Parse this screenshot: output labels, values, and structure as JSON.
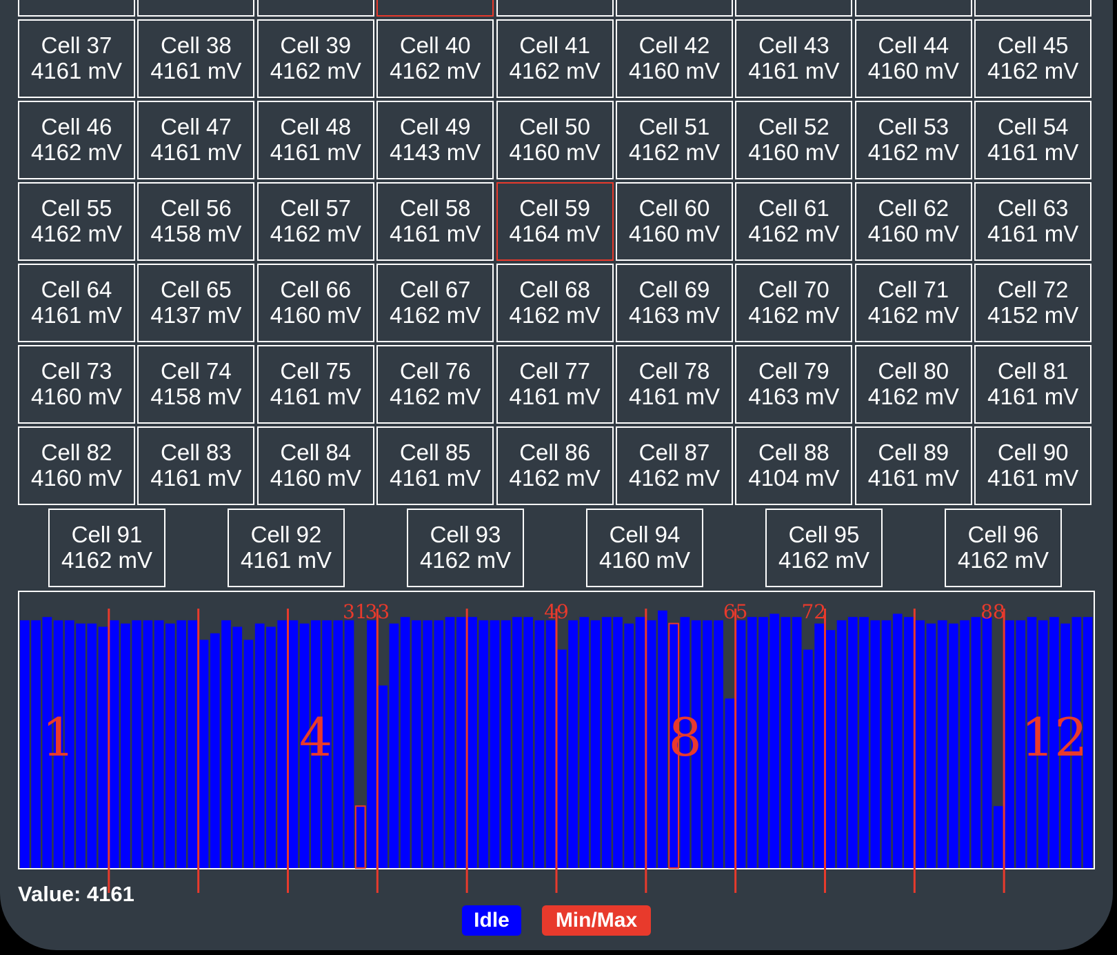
{
  "cells": [
    {
      "label": "Cell 37",
      "value": "4161 mV"
    },
    {
      "label": "Cell 38",
      "value": "4161 mV"
    },
    {
      "label": "Cell 39",
      "value": "4162 mV"
    },
    {
      "label": "Cell 40",
      "value": "4162 mV"
    },
    {
      "label": "Cell 41",
      "value": "4162 mV"
    },
    {
      "label": "Cell 42",
      "value": "4160 mV"
    },
    {
      "label": "Cell 43",
      "value": "4161 mV"
    },
    {
      "label": "Cell 44",
      "value": "4160 mV"
    },
    {
      "label": "Cell 45",
      "value": "4162 mV"
    },
    {
      "label": "Cell 46",
      "value": "4162 mV"
    },
    {
      "label": "Cell 47",
      "value": "4161 mV"
    },
    {
      "label": "Cell 48",
      "value": "4161 mV"
    },
    {
      "label": "Cell 49",
      "value": "4143 mV"
    },
    {
      "label": "Cell 50",
      "value": "4160 mV"
    },
    {
      "label": "Cell 51",
      "value": "4162 mV"
    },
    {
      "label": "Cell 52",
      "value": "4160 mV"
    },
    {
      "label": "Cell 53",
      "value": "4162 mV"
    },
    {
      "label": "Cell 54",
      "value": "4161 mV"
    },
    {
      "label": "Cell 55",
      "value": "4162 mV"
    },
    {
      "label": "Cell 56",
      "value": "4158 mV"
    },
    {
      "label": "Cell 57",
      "value": "4162 mV"
    },
    {
      "label": "Cell 58",
      "value": "4161 mV"
    },
    {
      "label": "Cell 59",
      "value": "4164 mV",
      "flag": true
    },
    {
      "label": "Cell 60",
      "value": "4160 mV"
    },
    {
      "label": "Cell 61",
      "value": "4162 mV"
    },
    {
      "label": "Cell 62",
      "value": "4160 mV"
    },
    {
      "label": "Cell 63",
      "value": "4161 mV"
    },
    {
      "label": "Cell 64",
      "value": "4161 mV"
    },
    {
      "label": "Cell 65",
      "value": "4137 mV"
    },
    {
      "label": "Cell 66",
      "value": "4160 mV"
    },
    {
      "label": "Cell 67",
      "value": "4162 mV"
    },
    {
      "label": "Cell 68",
      "value": "4162 mV"
    },
    {
      "label": "Cell 69",
      "value": "4163 mV"
    },
    {
      "label": "Cell 70",
      "value": "4162 mV"
    },
    {
      "label": "Cell 71",
      "value": "4162 mV"
    },
    {
      "label": "Cell 72",
      "value": "4152 mV"
    },
    {
      "label": "Cell 73",
      "value": "4160 mV"
    },
    {
      "label": "Cell 74",
      "value": "4158 mV"
    },
    {
      "label": "Cell 75",
      "value": "4161 mV"
    },
    {
      "label": "Cell 76",
      "value": "4162 mV"
    },
    {
      "label": "Cell 77",
      "value": "4161 mV"
    },
    {
      "label": "Cell 78",
      "value": "4161 mV"
    },
    {
      "label": "Cell 79",
      "value": "4163 mV"
    },
    {
      "label": "Cell 80",
      "value": "4162 mV"
    },
    {
      "label": "Cell 81",
      "value": "4161 mV"
    },
    {
      "label": "Cell 82",
      "value": "4160 mV"
    },
    {
      "label": "Cell 83",
      "value": "4161 mV"
    },
    {
      "label": "Cell 84",
      "value": "4160 mV"
    },
    {
      "label": "Cell 85",
      "value": "4161 mV"
    },
    {
      "label": "Cell 86",
      "value": "4162 mV"
    },
    {
      "label": "Cell 87",
      "value": "4162 mV"
    },
    {
      "label": "Cell 88",
      "value": "4104 mV"
    },
    {
      "label": "Cell 89",
      "value": "4161 mV"
    },
    {
      "label": "Cell 90",
      "value": "4161 mV"
    }
  ],
  "last_row_cells": [
    {
      "label": "Cell 91",
      "value": "4162 mV"
    },
    {
      "label": "Cell 92",
      "value": "4161 mV"
    },
    {
      "label": "Cell 93",
      "value": "4162 mV"
    },
    {
      "label": "Cell 94",
      "value": "4160 mV"
    },
    {
      "label": "Cell 95",
      "value": "4162 mV"
    },
    {
      "label": "Cell 96",
      "value": "4162 mV"
    }
  ],
  "colors": {
    "idle": "#0000ff",
    "minmax": "#e83a2c",
    "panel": "#323b44",
    "border": "#ffffff"
  },
  "chart_data": {
    "type": "bar",
    "series_name": "cell voltage (mV)",
    "values": [
      4161,
      4161,
      4162,
      4161,
      4161,
      4160,
      4160,
      4159,
      4161,
      4160,
      4161,
      4161,
      4161,
      4160,
      4161,
      4161,
      4155,
      4157,
      4161,
      4159,
      4155,
      4160,
      4159,
      4161,
      4161,
      4160,
      4161,
      4161,
      4161,
      4161,
      4104,
      4161,
      4141,
      4160,
      4162,
      4161,
      4161,
      4161,
      4162,
      4162,
      4162,
      4161,
      4161,
      4161,
      4162,
      4162,
      4161,
      4161,
      4152,
      4161,
      4162,
      4161,
      4162,
      4162,
      4160,
      4162,
      4161,
      4164,
      4160,
      4162,
      4161,
      4161,
      4161,
      4137,
      4161,
      4162,
      4162,
      4163,
      4162,
      4162,
      4152,
      4160,
      4158,
      4161,
      4162,
      4162,
      4161,
      4161,
      4163,
      4162,
      4161,
      4160,
      4161,
      4160,
      4161,
      4162,
      4162,
      4104,
      4161,
      4161,
      4162,
      4161,
      4162,
      4160,
      4162,
      4162
    ],
    "ylim": [
      4085,
      4165
    ],
    "min_cell": 31,
    "max_cell": 59,
    "group_dividers_after": [
      8,
      16,
      24,
      32,
      40,
      48,
      56,
      64,
      72,
      80,
      88
    ],
    "group_labels": [
      {
        "text": "1",
        "at_cell": 4
      },
      {
        "text": "4",
        "at_cell": 27
      },
      {
        "text": "8",
        "at_cell": 60
      },
      {
        "text": "12",
        "at_cell": 93
      }
    ],
    "marker_labels": [
      {
        "text": "31",
        "cell": 31
      },
      {
        "text": "33",
        "cell": 33
      },
      {
        "text": "49",
        "cell": 49
      },
      {
        "text": "65",
        "cell": 65
      },
      {
        "text": "72",
        "cell": 72
      },
      {
        "text": "88",
        "cell": 88
      }
    ]
  },
  "readout": "Value: 4161",
  "legend": {
    "idle": "Idle",
    "minmax": "Min/Max"
  }
}
